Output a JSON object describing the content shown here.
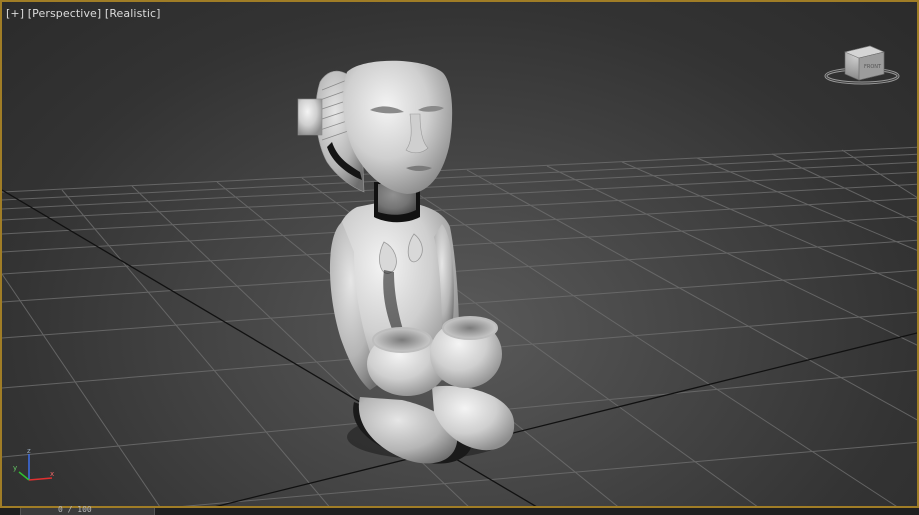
{
  "viewport": {
    "label_plus": "[+]",
    "label_view": "[Perspective]",
    "label_shading": "[Realistic]",
    "border_color": "#a07d26"
  },
  "viewcube": {
    "face_top": "TOP",
    "face_front": "FRONT"
  },
  "axis_tripod": {
    "x": "x",
    "y": "y",
    "z": "z"
  },
  "timebar": {
    "frame_label": "0 / 100"
  },
  "icons": [
    "viewcube-icon",
    "axis-tripod-icon"
  ]
}
